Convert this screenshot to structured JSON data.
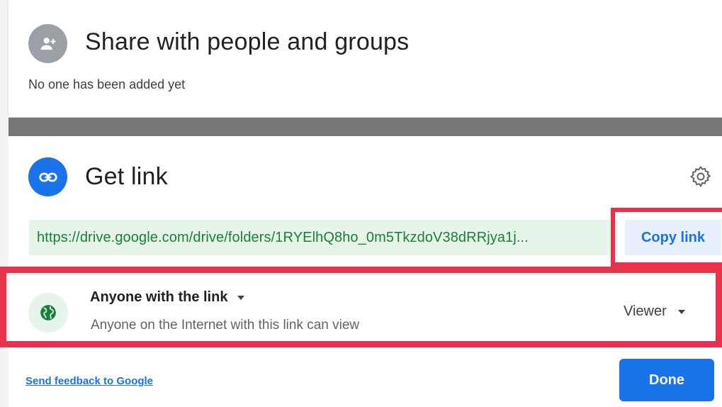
{
  "share": {
    "title": "Share with people and groups",
    "subtitle": "No one has been added yet"
  },
  "get_link": {
    "title": "Get link",
    "url": "https://drive.google.com/drive/folders/1RYElhQ8ho_0m5TkzdoV38dRRjya1j...",
    "copy_label": "Copy link"
  },
  "access": {
    "title": "Anyone with the link",
    "description": "Anyone on the Internet with this link can view",
    "role": "Viewer"
  },
  "footer": {
    "feedback_label": "Send feedback to Google",
    "done_label": "Done"
  },
  "icons": {
    "share": "add-person-icon",
    "link": "link-icon",
    "settings": "gear-icon",
    "access": "globe-icon"
  },
  "colors": {
    "primary": "#1a73e8",
    "link_text": "#188038",
    "link_bg": "#e6f4ea",
    "highlight": "#e8324c"
  }
}
